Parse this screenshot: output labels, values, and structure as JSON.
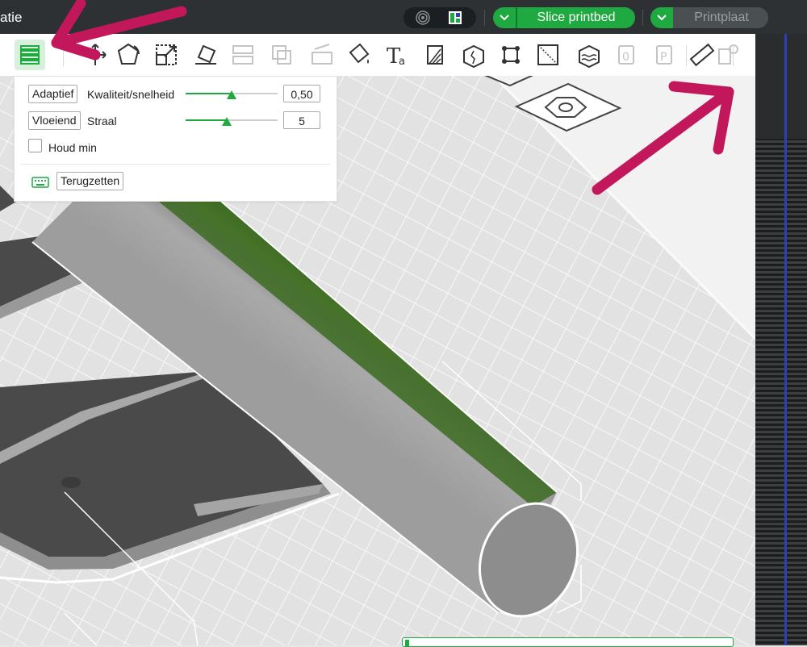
{
  "app": {
    "title": "atie"
  },
  "topbar": {
    "view_toggle": {
      "left_icon": "3d-view-icon",
      "right_icon": "preview-icon"
    },
    "slice": {
      "label": "Slice printbed",
      "color": "#1fa941"
    },
    "print": {
      "label": "Printplaat",
      "enabled": false
    }
  },
  "toolbar": {
    "tools": [
      {
        "name": "variable-layer-height-icon",
        "active": true
      },
      {
        "name": "move-icon"
      },
      {
        "name": "rotate-icon"
      },
      {
        "name": "scale-icon"
      },
      {
        "name": "lay-on-face-icon"
      },
      {
        "name": "split-objects-icon",
        "enabled": false
      },
      {
        "name": "split-parts-icon",
        "enabled": false
      },
      {
        "name": "cut-icon",
        "enabled": false
      },
      {
        "name": "paint-icon"
      },
      {
        "name": "text-icon"
      },
      {
        "name": "support-paint-icon"
      },
      {
        "name": "seam-paint-icon"
      },
      {
        "name": "brim-ears-icon"
      },
      {
        "name": "measure-box-icon"
      },
      {
        "name": "fuzzy-skin-icon"
      },
      {
        "name": "assembly-icon",
        "enabled": false
      },
      {
        "name": "plate-icon",
        "enabled": false
      },
      {
        "name": "ruler-icon"
      },
      {
        "name": "emboss-icon",
        "enabled": false
      }
    ]
  },
  "layer_popup": {
    "adaptive_button": "Adaptief",
    "quality_label": "Kwaliteit/snelheid",
    "quality_value": "0,50",
    "quality_fraction": 0.5,
    "smooth_button": "Vloeiend",
    "radius_label": "Straal",
    "radius_value": "5",
    "radius_fraction": 0.45,
    "keep_min_label": "Houd min",
    "keep_min_checked": false,
    "reset_button": "Terugzetten"
  },
  "colors": {
    "accent": "#1fa941",
    "annotation": "#c2185b",
    "topbar": "#2d3134",
    "timeline": "#2b3fb8"
  }
}
